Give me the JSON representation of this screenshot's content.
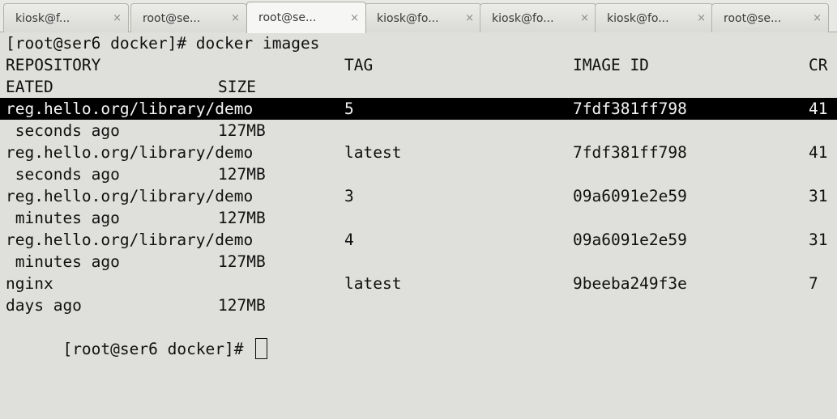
{
  "tabs": [
    {
      "label": "kiosk@f...",
      "close": "×",
      "active": false
    },
    {
      "label": "root@se...",
      "close": "×",
      "active": false
    },
    {
      "label": "root@se...",
      "close": "×",
      "active": true
    },
    {
      "label": "kiosk@fo...",
      "close": "×",
      "active": false
    },
    {
      "label": "kiosk@fo...",
      "close": "×",
      "active": false
    },
    {
      "label": "kiosk@fo...",
      "close": "×",
      "active": false
    },
    {
      "label": "root@se...",
      "close": "×",
      "active": false
    }
  ],
  "terminal": {
    "prompt": "[root@ser6 docker]# docker images",
    "header": {
      "repository": "REPOSITORY",
      "tag": "TAG",
      "image_id": "IMAGE ID",
      "created_part1": "CR",
      "created_part2": "EATED",
      "size": "SIZE"
    },
    "rows": [
      {
        "repository": "reg.hello.org/library/demo",
        "tag": "5",
        "image_id": "7fdf381ff798",
        "created_num": "41",
        "created_rest": " seconds ago",
        "size": "127MB",
        "selected": true
      },
      {
        "repository": "reg.hello.org/library/demo",
        "tag": "latest",
        "image_id": "7fdf381ff798",
        "created_num": "41",
        "created_rest": " seconds ago",
        "size": "127MB",
        "selected": false
      },
      {
        "repository": "reg.hello.org/library/demo",
        "tag": "3",
        "image_id": "09a6091e2e59",
        "created_num": "31",
        "created_rest": " minutes ago",
        "size": "127MB",
        "selected": false
      },
      {
        "repository": "reg.hello.org/library/demo",
        "tag": "4",
        "image_id": "09a6091e2e59",
        "created_num": "31",
        "created_rest": " minutes ago",
        "size": "127MB",
        "selected": false
      },
      {
        "repository": "nginx",
        "tag": "latest",
        "image_id": "9beeba249f3e",
        "created_num": "7",
        "created_rest": "days ago",
        "size": "127MB",
        "selected": false
      }
    ],
    "final_prompt": "[root@ser6 docker]# "
  },
  "colors": {
    "terminal_bg": "#dfdfdb",
    "text": "#101010",
    "selection_bg": "#000000",
    "selection_fg": "#f4f4f4"
  }
}
